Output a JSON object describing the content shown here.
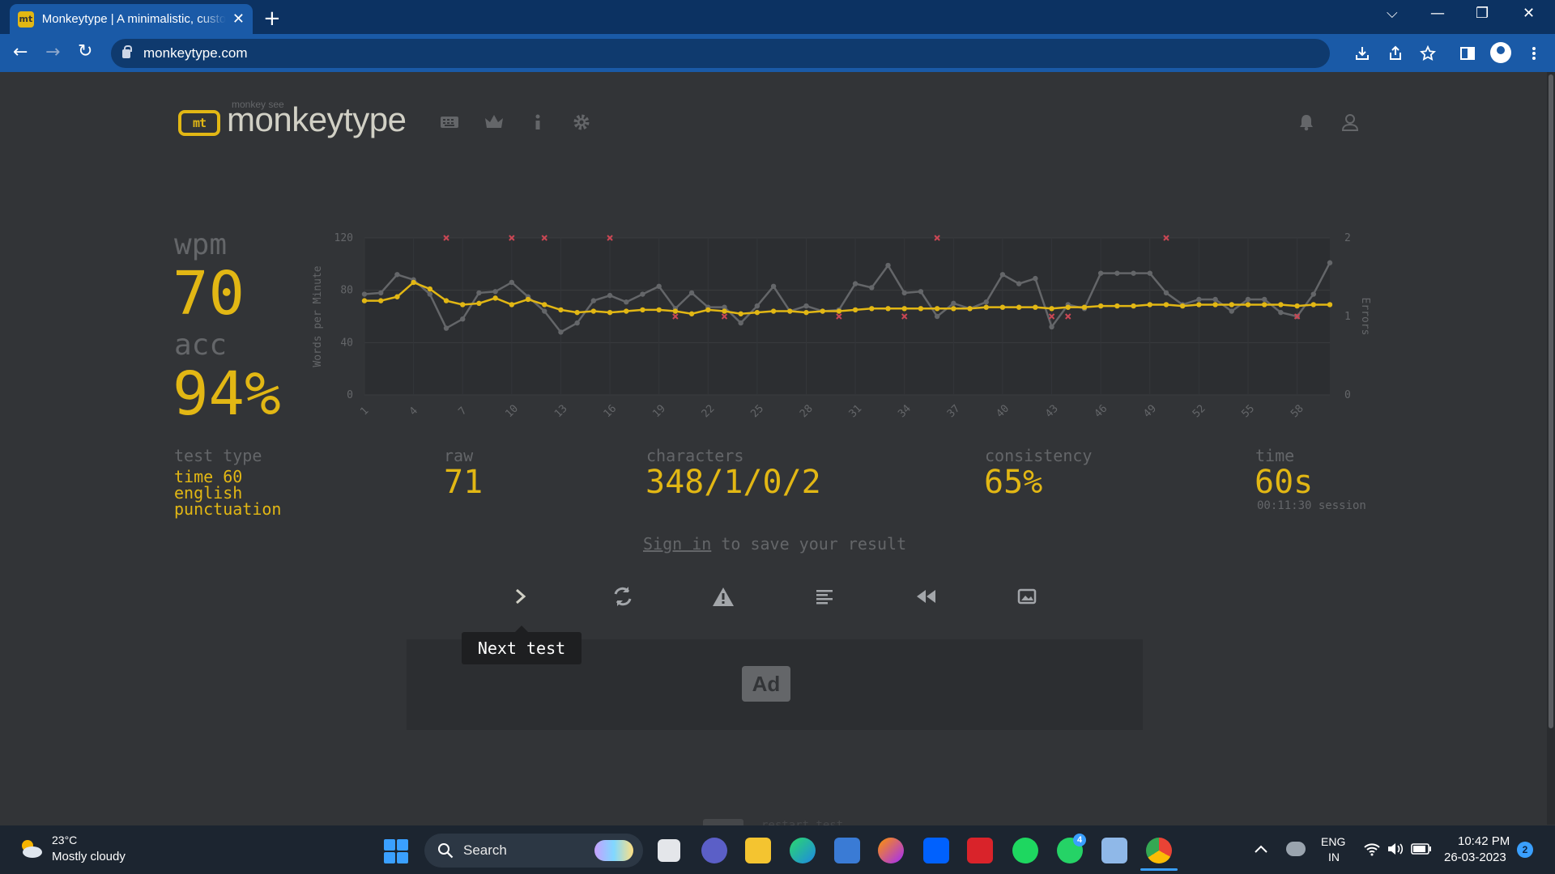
{
  "browser": {
    "tab_title": "Monkeytype | A minimalistic, customizable typing test",
    "favicon_text": "mt",
    "tab_close": "✕",
    "new_tab": "+",
    "url": "monkeytype.com",
    "controls": {
      "dropdown": "⌵",
      "minimize": "—",
      "restore": "❐",
      "close": "✕"
    },
    "nav": {
      "back": "←",
      "forward": "→",
      "reload": "↻"
    },
    "toolbar_icons": [
      "install-icon",
      "share-icon",
      "star-icon",
      "sidepanel-icon",
      "profile-icon",
      "menu-icon"
    ]
  },
  "header": {
    "logo_mark": "mt",
    "logo_subtitle": "monkey see",
    "logo_text": "monkeytype",
    "nav_icons": [
      "keyboard-icon",
      "crown-icon",
      "info-icon",
      "gear-icon"
    ],
    "right_icons": [
      "bell-icon",
      "user-icon"
    ]
  },
  "results": {
    "wpm_label": "wpm",
    "wpm_value": "70",
    "acc_label": "acc",
    "acc_value": "94%",
    "test_type_label": "test type",
    "test_type_lines": [
      "time 60",
      "english",
      "punctuation"
    ],
    "raw_label": "raw",
    "raw_value": "71",
    "characters_label": "characters",
    "characters_value": "348/1/0/2",
    "consistency_label": "consistency",
    "consistency_value": "65%",
    "time_label": "time",
    "time_value": "60s",
    "session_text": "00:11:30 session",
    "signin_link": "Sign in",
    "signin_rest": " to save your result"
  },
  "actions": {
    "buttons": [
      "next-test",
      "restart-test",
      "report",
      "words-history",
      "replay",
      "screenshot"
    ],
    "tooltip": "Next test"
  },
  "ad": {
    "label": "Ad"
  },
  "footer": {
    "hint": "restart test"
  },
  "taskbar": {
    "weather_temp": "23°C",
    "weather_desc": "Mostly cloudy",
    "search_placeholder": "Search",
    "lang_1": "ENG",
    "lang_2": "IN",
    "time": "10:42 PM",
    "date": "26-03-2023",
    "notification_count": "2",
    "whatsapp_badge": "4"
  },
  "colors": {
    "accent": "#e2b714",
    "sub": "#646669",
    "bg": "#323437",
    "error": "#ca4754",
    "text": "#d1d0c5"
  },
  "chart_data": {
    "type": "line",
    "ylabel": "Words per Minute",
    "y2label": "Errors",
    "ylim": [
      0,
      120
    ],
    "y2lim": [
      0,
      2
    ],
    "yticks": [
      "0",
      "40",
      "80",
      "120"
    ],
    "y2ticks": [
      "0",
      "1",
      "2"
    ],
    "xticks": [
      "1",
      "4",
      "7",
      "10",
      "13",
      "16",
      "19",
      "22",
      "25",
      "28",
      "31",
      "34",
      "37",
      "40",
      "43",
      "46",
      "49",
      "52",
      "55",
      "58"
    ],
    "x": [
      1,
      2,
      3,
      4,
      5,
      6,
      7,
      8,
      9,
      10,
      11,
      12,
      13,
      14,
      15,
      16,
      17,
      18,
      19,
      20,
      21,
      22,
      23,
      24,
      25,
      26,
      27,
      28,
      29,
      30,
      31,
      32,
      33,
      34,
      35,
      36,
      37,
      38,
      39,
      40,
      41,
      42,
      43,
      44,
      45,
      46,
      47,
      48,
      49,
      50,
      51,
      52,
      53,
      54,
      55,
      56,
      57,
      58,
      59,
      60
    ],
    "series": [
      {
        "name": "wpm",
        "color": "#e2b714",
        "values": [
          72,
          72,
          75,
          86,
          81,
          72,
          69,
          70,
          74,
          69,
          73,
          69,
          65,
          63,
          64,
          63,
          64,
          65,
          65,
          64,
          62,
          65,
          64,
          62,
          63,
          64,
          64,
          63,
          64,
          64,
          65,
          66,
          66,
          66,
          66,
          66,
          66,
          66,
          67,
          67,
          67,
          67,
          66,
          67,
          67,
          68,
          68,
          68,
          69,
          69,
          68,
          69,
          69,
          69,
          69,
          69,
          69,
          68,
          69,
          69
        ]
      },
      {
        "name": "raw",
        "color": "#646669",
        "values": [
          77,
          78,
          92,
          88,
          77,
          51,
          58,
          78,
          79,
          86,
          75,
          64,
          48,
          55,
          72,
          76,
          71,
          77,
          83,
          66,
          78,
          67,
          67,
          55,
          68,
          83,
          64,
          68,
          64,
          65,
          85,
          82,
          99,
          78,
          79,
          60,
          70,
          66,
          71,
          92,
          85,
          89,
          52,
          69,
          66,
          93,
          93,
          93,
          93,
          78,
          69,
          73,
          73,
          64,
          73,
          73,
          63,
          60,
          77,
          101
        ]
      },
      {
        "name": "errors",
        "color": "#ca4754",
        "axis": "right",
        "points": [
          [
            6,
            2
          ],
          [
            10,
            2
          ],
          [
            12,
            2
          ],
          [
            16,
            2
          ],
          [
            20,
            1
          ],
          [
            23,
            1
          ],
          [
            30,
            1
          ],
          [
            34,
            1
          ],
          [
            36,
            2
          ],
          [
            43,
            1
          ],
          [
            44,
            1
          ],
          [
            50,
            2
          ],
          [
            58,
            1
          ]
        ]
      }
    ]
  }
}
